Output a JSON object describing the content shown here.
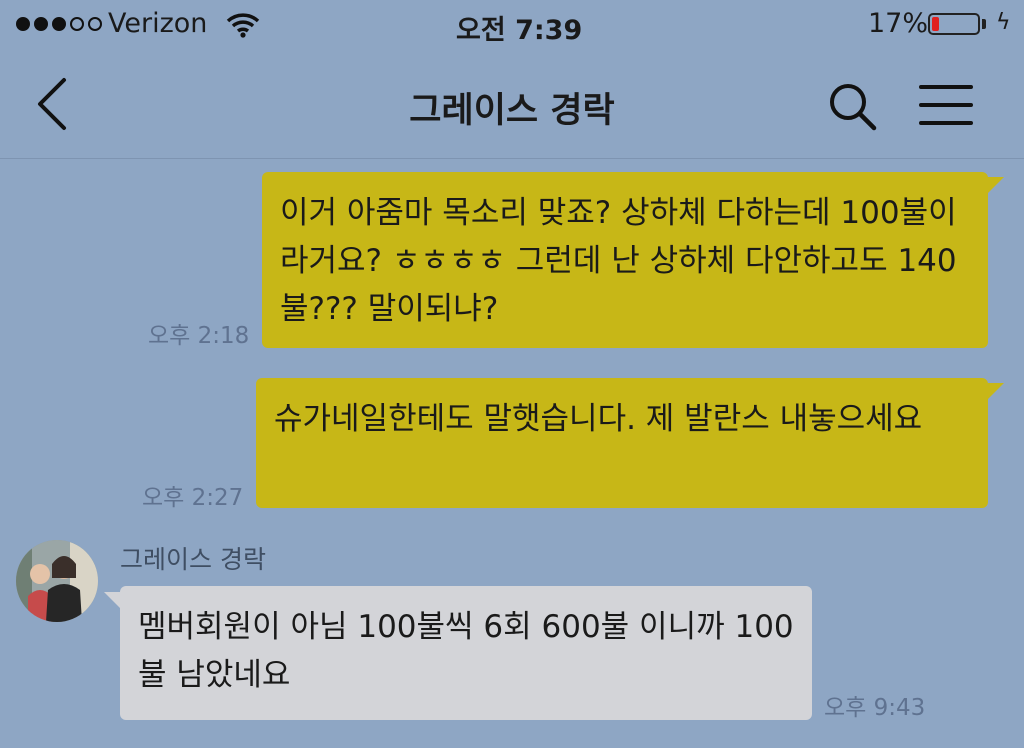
{
  "status_bar": {
    "carrier": "Verizon",
    "time": "오전 7:39",
    "battery": "17%",
    "battery_level": 0.17,
    "colors": {
      "battery_low": "#e02020"
    }
  },
  "header": {
    "title": "그레이스 경락",
    "icons": [
      "back-chevron-icon",
      "search-icon",
      "menu-icon"
    ]
  },
  "messages": [
    {
      "direction": "outgoing",
      "text": "이거 아줌마 목소리 맞죠? 상하체 다하는데 100불이라거요? ㅎㅎㅎㅎ 그런데 난 상하체 다안하고도 140불??? 말이되냐?",
      "time": "오후 2:18"
    },
    {
      "direction": "outgoing",
      "text": "슈가네일한테도 말햇습니다. 제 발란스 내놓으세요",
      "time": "오후 2:27"
    },
    {
      "direction": "incoming",
      "sender": "그레이스 경락",
      "text": "멤버회원이 아님 100불씩 6회 600불 이니까 100불 남았네요",
      "time": "오후 9:43"
    }
  ],
  "colors": {
    "background": "#8ea6c4",
    "outgoing_bubble": "#c7b717",
    "incoming_bubble": "#d3d4d8"
  }
}
